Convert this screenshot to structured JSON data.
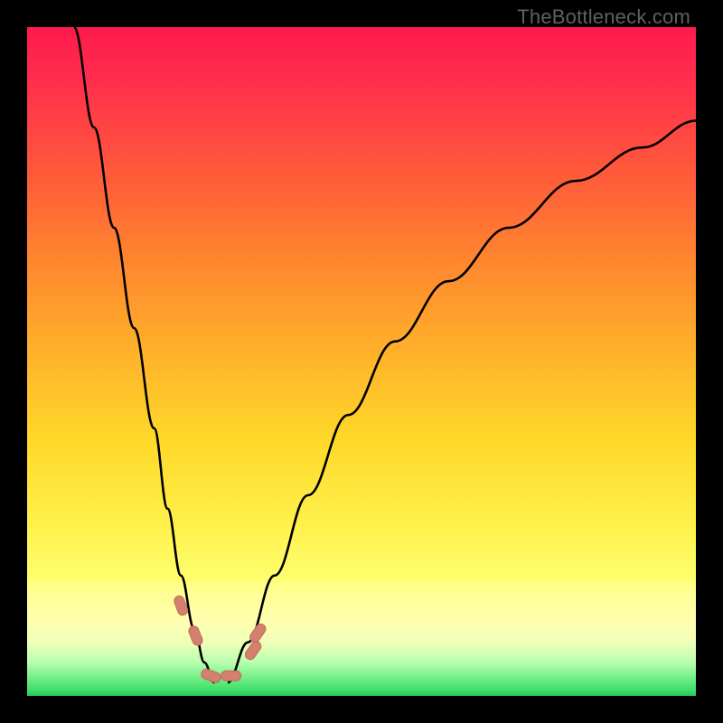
{
  "watermark": "TheBottleneck.com",
  "chart_data": {
    "type": "line",
    "title": "",
    "xlabel": "",
    "ylabel": "",
    "xlim": [
      0,
      100
    ],
    "ylim": [
      0,
      100
    ],
    "note": "Axes are unmarked; values are normalized 0–100 estimated from pixel positions. y=100 is top of plot.",
    "series": [
      {
        "name": "left-curve",
        "x": [
          7,
          10,
          13,
          16,
          19,
          21,
          23,
          25,
          26.5,
          28
        ],
        "y": [
          100,
          85,
          70,
          55,
          40,
          28,
          18,
          10,
          5,
          2
        ]
      },
      {
        "name": "right-curve",
        "x": [
          30,
          33,
          37,
          42,
          48,
          55,
          63,
          72,
          82,
          92,
          100
        ],
        "y": [
          2,
          8,
          18,
          30,
          42,
          53,
          62,
          70,
          77,
          82,
          86
        ]
      }
    ],
    "markers": [
      {
        "shape": "capsule",
        "x": 23.0,
        "y": 13.5,
        "angle": 70
      },
      {
        "shape": "capsule",
        "x": 25.2,
        "y": 9.0,
        "angle": 68
      },
      {
        "shape": "capsule",
        "x": 27.5,
        "y": 3.0,
        "angle": 20
      },
      {
        "shape": "capsule",
        "x": 30.5,
        "y": 3.0,
        "angle": 0
      },
      {
        "shape": "capsule",
        "x": 33.8,
        "y": 6.8,
        "angle": -55
      },
      {
        "shape": "capsule",
        "x": 34.5,
        "y": 9.4,
        "angle": -55
      }
    ],
    "background_gradient": {
      "top": "#ff1a4d",
      "mid": "#ffd92a",
      "bottom": "#2bc85c"
    }
  }
}
